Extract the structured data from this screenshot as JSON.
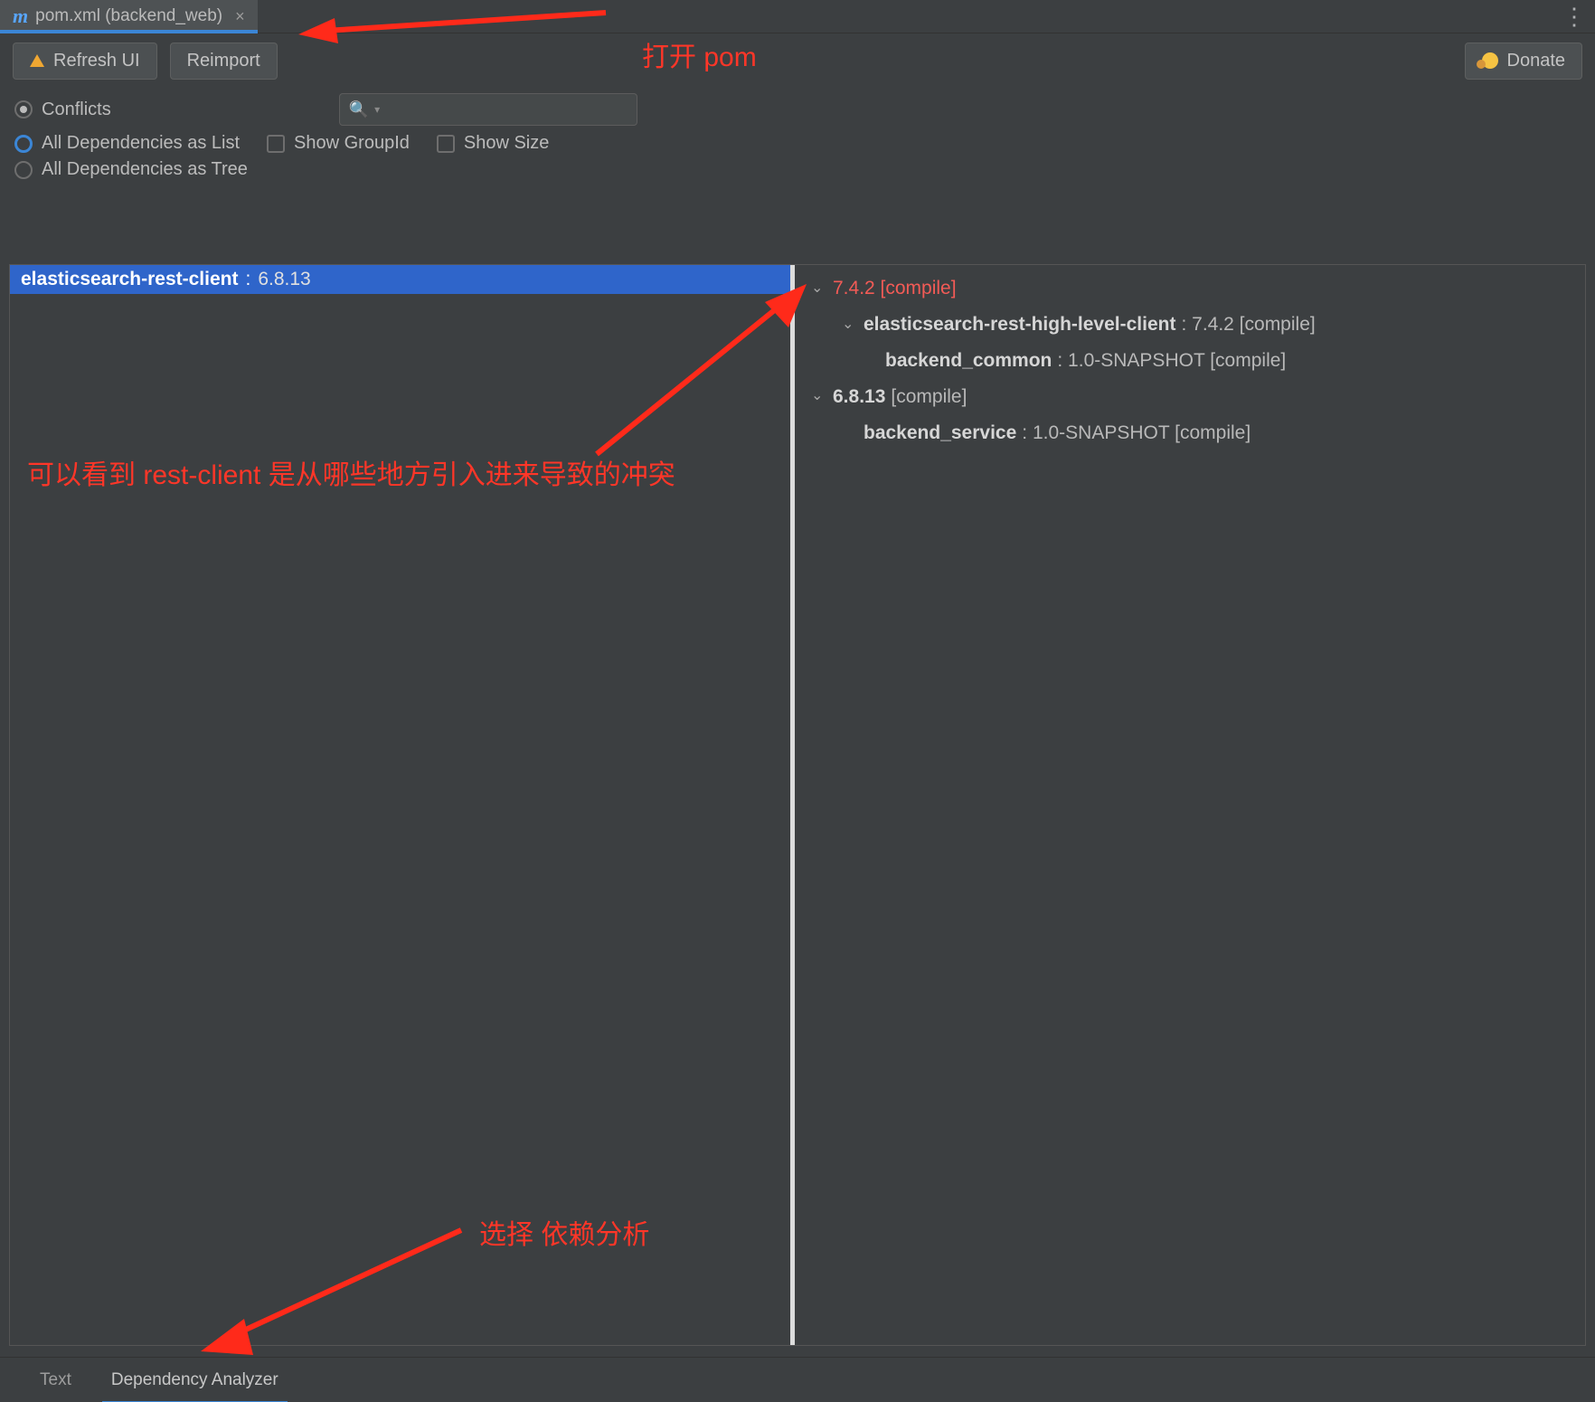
{
  "tab": {
    "label": "pom.xml (backend_web)"
  },
  "toolbar": {
    "refresh_label": "Refresh UI",
    "reimport_label": "Reimport",
    "donate_label": "Donate"
  },
  "search": {
    "placeholder": ""
  },
  "filters": {
    "conflicts_label": "Conflicts",
    "all_list_label": "All Dependencies as List",
    "all_tree_label": "All Dependencies as Tree",
    "show_groupid_label": "Show GroupId",
    "show_size_label": "Show Size"
  },
  "left_panel": {
    "selected_name": "elasticsearch-rest-client",
    "selected_sep": " : ",
    "selected_ver": "6.8.13"
  },
  "right_panel": {
    "v742_label": "7.4.2 [compile]",
    "hl_client_name": "elasticsearch-rest-high-level-client",
    "hl_client_rest": " : 7.4.2 [compile]",
    "backend_common_name": "backend_common",
    "backend_common_rest": " : 1.0-SNAPSHOT [compile]",
    "v6813_label": "6.8.13",
    "v6813_rest": " [compile]",
    "backend_service_name": "backend_service",
    "backend_service_rest": " : 1.0-SNAPSHOT [compile]"
  },
  "bottom_tabs": {
    "text_label": "Text",
    "analyzer_label": "Dependency Analyzer"
  },
  "annotations": {
    "open_pom": "打开 pom",
    "conflict_source": "可以看到 rest-client 是从哪些地方引入进来导致的冲突",
    "select_analyzer": "选择 依赖分析"
  }
}
